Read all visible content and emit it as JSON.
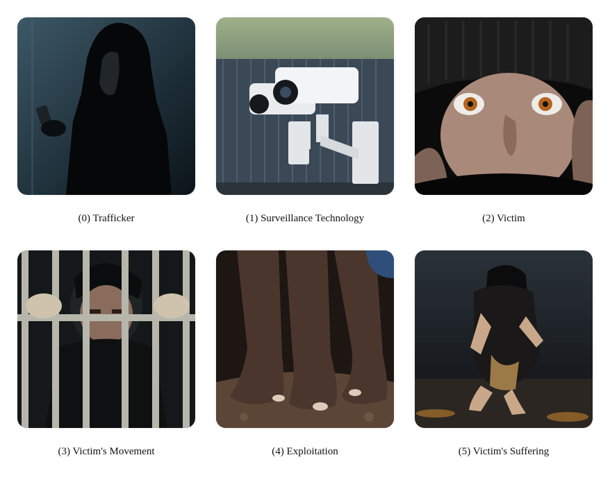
{
  "panels": [
    {
      "caption": "(0) Trafficker"
    },
    {
      "caption": "(1) Surveillance Technology"
    },
    {
      "caption": "(2) Victim"
    },
    {
      "caption": "(3) Victim's Movement"
    },
    {
      "caption": "(4) Exploitation"
    },
    {
      "caption": "(5) Victim's Suffering"
    }
  ]
}
